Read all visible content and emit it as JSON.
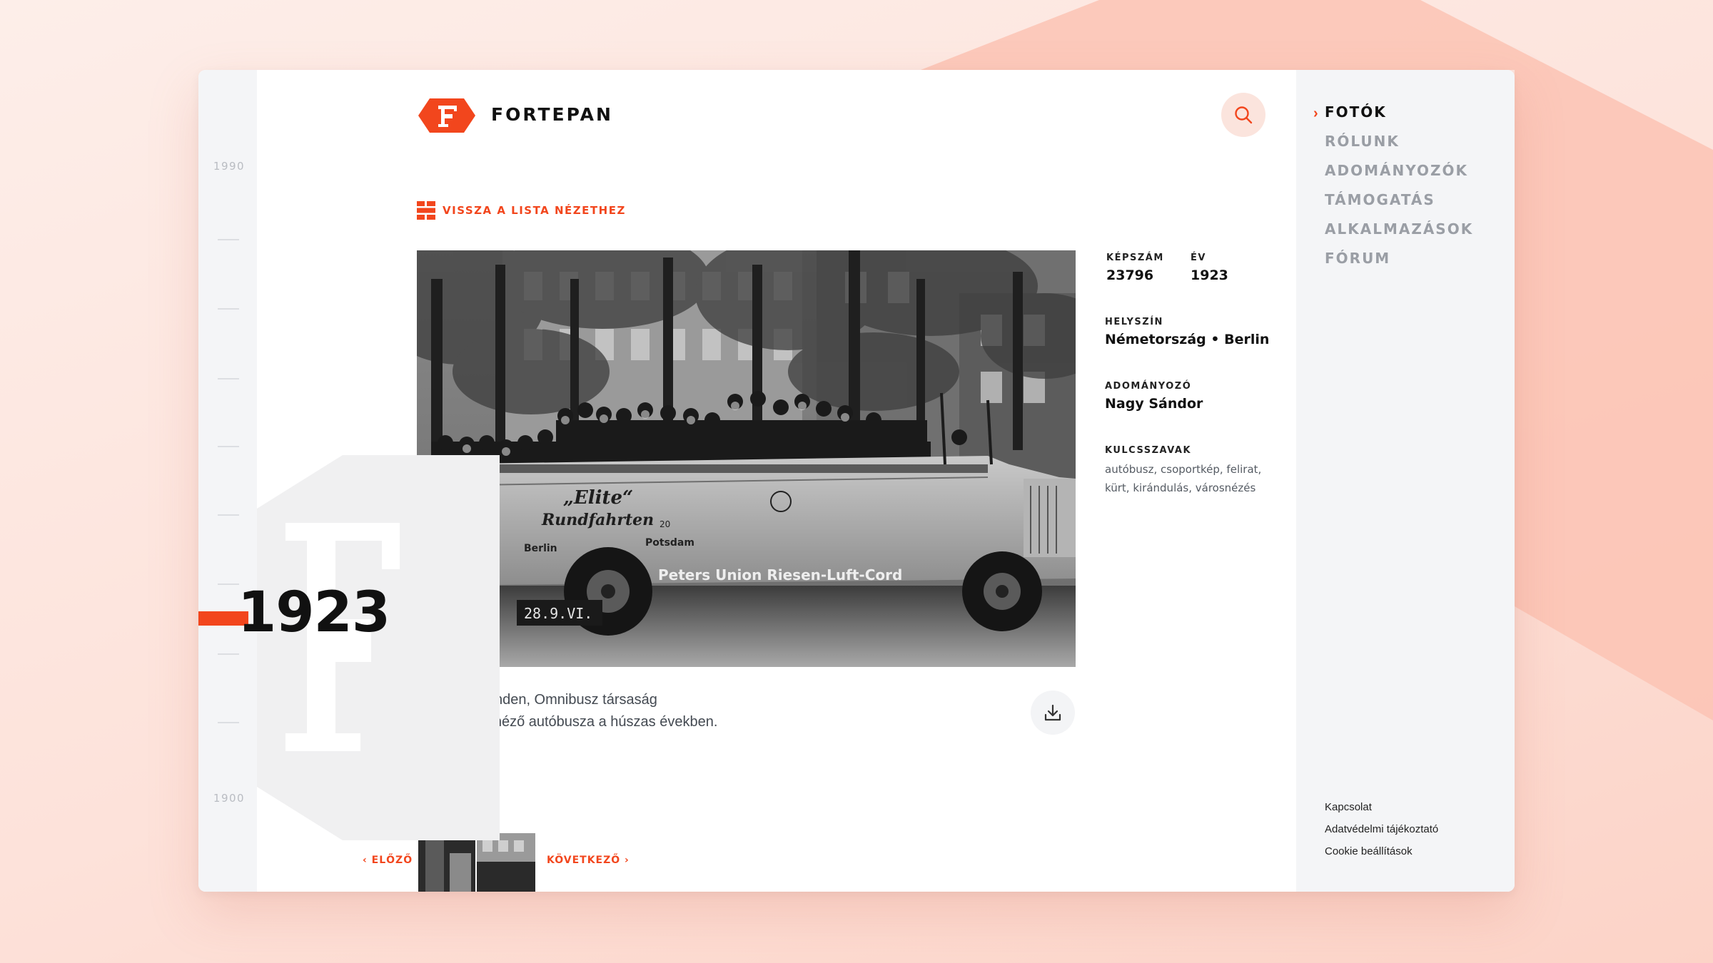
{
  "brand": {
    "name": "FORTEPAN",
    "logo_letter": "F",
    "accent": "#f2461d"
  },
  "header": {
    "search_icon": "search-icon"
  },
  "timeline": {
    "top_year": "1990",
    "bottom_year": "1900",
    "current_year": "1923"
  },
  "back_link": {
    "label": "VISSZA A LISTA NÉZETHEZ",
    "icon": "grid-icon"
  },
  "photo": {
    "caption_line1": "Unter den Linden, Omnibusz társaság",
    "caption_line2": "nyitott városnéző autóbusza a húszas években.",
    "bus_text_1": "„Elite“",
    "bus_text_2": "Rundfahrten",
    "bus_text_3": "Berlin",
    "bus_text_4": "Potsdam",
    "bus_text_5": "Peters Union Riesen-Luft-Cord",
    "bus_text_6": "20",
    "plate_text": "28.9.VI."
  },
  "meta": {
    "id_label": "KÉPSZÁM",
    "id_value": "23796",
    "year_label": "ÉV",
    "year_value": "1923",
    "location_label": "HELYSZÍN",
    "location_value": "Németország • Berlin",
    "donor_label": "ADOMÁNYOZÓ",
    "donor_value": "Nagy Sándor",
    "keywords_label": "KULCSSZAVAK",
    "keywords_value": "autóbusz, csoportkép, felirat, kürt, kirándulás, városnézés"
  },
  "pager": {
    "prev_label": "ELŐZŐ",
    "next_label": "KÖVETKEZŐ"
  },
  "nav": {
    "items": [
      {
        "label": "FOTÓK"
      },
      {
        "label": "RÓLUNK"
      },
      {
        "label": "ADOMÁNYOZÓK"
      },
      {
        "label": "TÁMOGATÁS"
      },
      {
        "label": "ALKALMAZÁSOK"
      },
      {
        "label": "FÓRUM"
      }
    ],
    "footer": [
      {
        "label": "Kapcsolat"
      },
      {
        "label": "Adatvédelmi tájékoztató"
      },
      {
        "label": "Cookie beállítások"
      }
    ]
  }
}
